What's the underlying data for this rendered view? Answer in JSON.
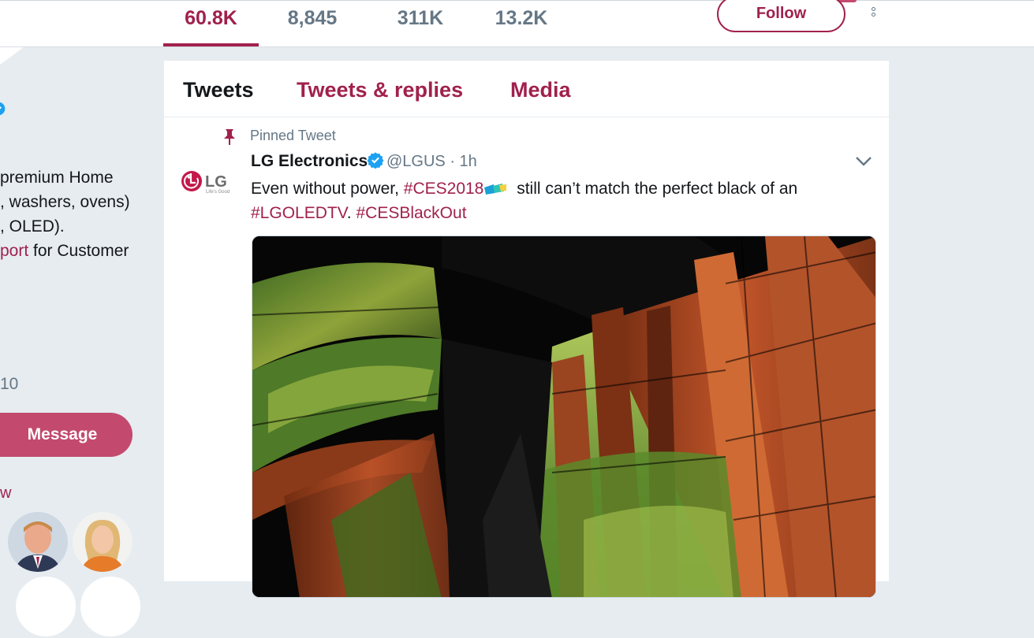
{
  "stats": [
    {
      "value": "60.8K",
      "active": true
    },
    {
      "value": "8,845",
      "active": false
    },
    {
      "value": "311K",
      "active": false
    },
    {
      "value": "13.2K",
      "active": false
    }
  ],
  "header": {
    "follow_label": "Follow"
  },
  "profile": {
    "bio_lines": [
      "premium Home",
      ", washers, ovens)",
      ", OLED)."
    ],
    "bio_link": "port",
    "bio_tail": " for Customer",
    "joined_fragment": "10",
    "message_label": "Message",
    "followers_you_know": "w"
  },
  "tabs": [
    "Tweets",
    "Tweets & replies",
    "Media"
  ],
  "tweet": {
    "pinned_label": "Pinned Tweet",
    "author_name": "LG Electronics",
    "handle": "@LGUS",
    "time": "· 1h",
    "text_1": "Even without power, ",
    "tag_1": "#CES2018",
    "text_2": " still can’t match the perfect black of an",
    "tag_2": "#LGOLEDTV",
    "text_3": ". ",
    "tag_3": "#CESBlackOut",
    "logo_text": "LG",
    "logo_tagline": "Life's Good"
  },
  "colors": {
    "accent": "#a0214d",
    "button_fill": "#c34a6e",
    "secondary_text": "#657786",
    "background": "#e6ecf0"
  }
}
